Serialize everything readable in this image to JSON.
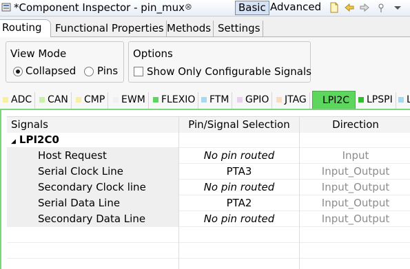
{
  "titlebar": {
    "title": "*Component Inspector - pin_mux",
    "close_glyph": "⊗",
    "mode_basic": "Basic",
    "mode_advanced": "Advanced"
  },
  "main_tabs": [
    "Routing",
    "Functional Properties",
    "Methods",
    "Settings"
  ],
  "view_mode": {
    "title": "View Mode",
    "options": [
      "Collapsed",
      "Pins"
    ],
    "selected": "Collapsed"
  },
  "options": {
    "title": "Options",
    "checkbox_label": "Show Only Configurable Signals",
    "checked": false
  },
  "peripheral_tabs": [
    {
      "label": "ADC",
      "color": "#f7f0a0"
    },
    {
      "label": "CAN",
      "color": "#c8f0a8"
    },
    {
      "label": "CMP",
      "color": "#f7f0a0"
    },
    {
      "label": "EWM",
      "color": "#f0f0f0"
    },
    {
      "label": "FLEXIO",
      "color": "#5cd65c"
    },
    {
      "label": "FTM",
      "color": "#a8d8f0"
    },
    {
      "label": "GPIO",
      "color": "#e8d0f0"
    },
    {
      "label": "JTAG",
      "color": "#f7dcc0"
    },
    {
      "label": "LPI2C",
      "color": "#5cd65c",
      "active": true
    },
    {
      "label": "LPSPI",
      "color": "#2ec02e"
    },
    {
      "label": "L",
      "color": "#a8d8f0"
    }
  ],
  "table": {
    "headers": [
      "Signals",
      "Pin/Signal Selection",
      "Direction"
    ],
    "group": "LPI2C0",
    "rows": [
      {
        "signal": "Host Request",
        "pin": "No pin routed",
        "direction": "Input"
      },
      {
        "signal": "Serial Clock Line",
        "pin": "PTA3",
        "direction": "Input_Output"
      },
      {
        "signal": "Secondary Clock line",
        "pin": "No pin routed",
        "direction": "Input_Output"
      },
      {
        "signal": "Serial Data Line",
        "pin": "PTA2",
        "direction": "Input_Output"
      },
      {
        "signal": "Secondary Data Line",
        "pin": "No pin routed",
        "direction": "Input_Output"
      }
    ]
  }
}
